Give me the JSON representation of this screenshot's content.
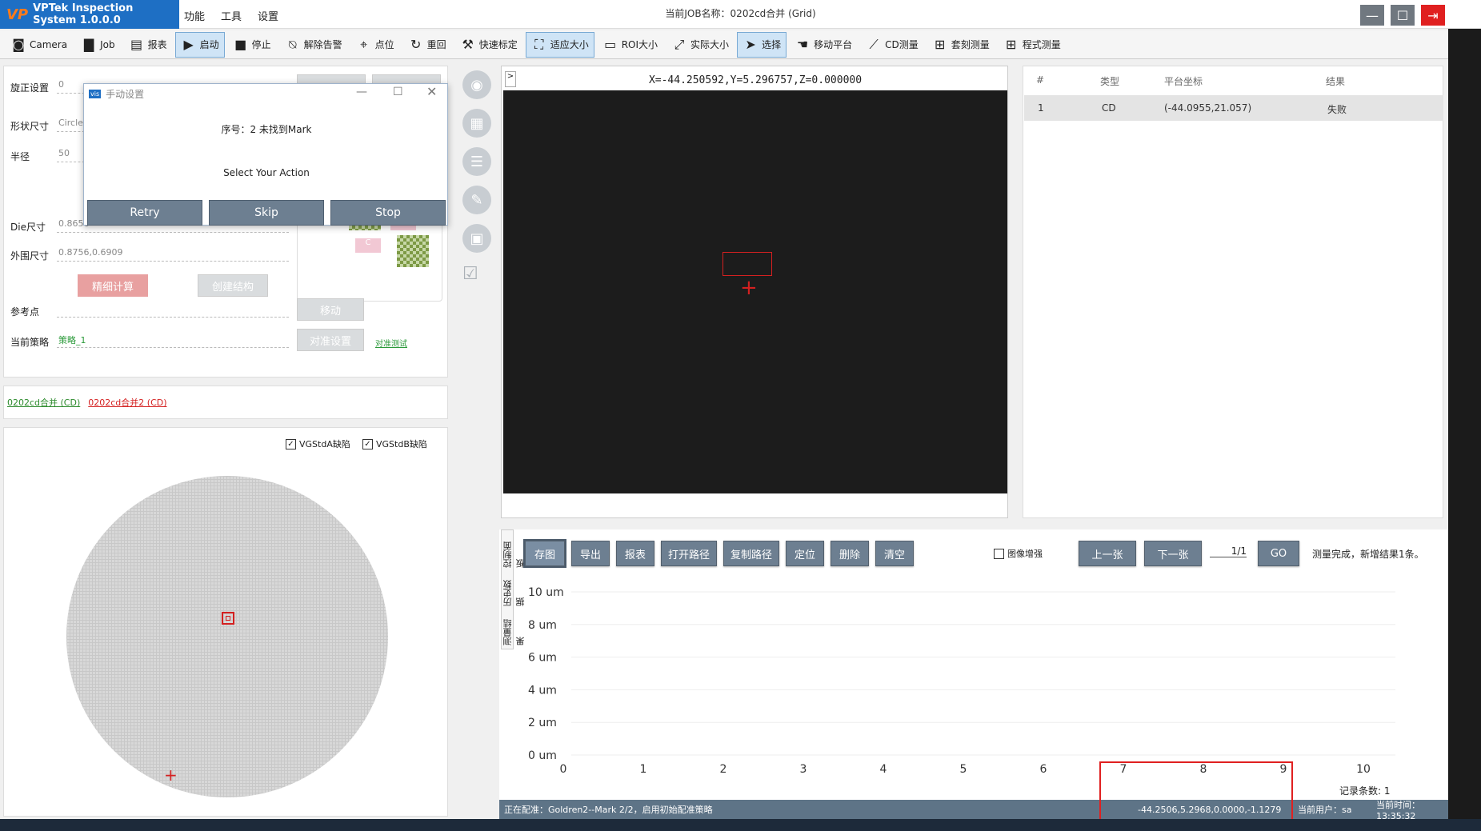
{
  "app": {
    "title": "VPTek Inspection System 1.0.0.0",
    "menus": [
      "功能",
      "工具",
      "设置"
    ],
    "job_title": "当前JOB名称：0202cd合并 (Grid)"
  },
  "toolbar": [
    {
      "label": "Camera",
      "icon": "camera-icon"
    },
    {
      "label": "Job",
      "icon": "briefcase-icon"
    },
    {
      "label": "报表",
      "icon": "report-icon"
    },
    {
      "label": "启动",
      "icon": "play-icon",
      "active": true
    },
    {
      "label": "停止",
      "icon": "stop-icon"
    },
    {
      "label": "解除告警",
      "icon": "bell-off-icon"
    },
    {
      "label": "点位",
      "icon": "pin-icon"
    },
    {
      "label": "重回",
      "icon": "refresh-icon"
    },
    {
      "label": "快速标定",
      "icon": "wrench-icon"
    },
    {
      "label": "适应大小",
      "icon": "fit-icon",
      "active": true
    },
    {
      "label": "ROI大小",
      "icon": "roi-icon"
    },
    {
      "label": "实际大小",
      "icon": "expand-icon"
    },
    {
      "label": "选择",
      "icon": "cursor-icon",
      "active": true
    },
    {
      "label": "移动平台",
      "icon": "hand-icon"
    },
    {
      "label": "CD测量",
      "icon": "ruler-icon"
    },
    {
      "label": "套刻测量",
      "icon": "plus-icon"
    },
    {
      "label": "程式测量",
      "icon": "plus-icon"
    }
  ],
  "left": {
    "rotate_label": "旋正设置",
    "rotate_value": "0",
    "shape_label": "形状尺寸",
    "shape_value": "Circle",
    "radius_label": "半径",
    "radius_value": "50",
    "die_label": "Die尺寸",
    "die_value": "0.8656",
    "outer_label": "外围尺寸",
    "outer_value": "0.8756,0.6909",
    "fine_calc": "精细计算",
    "create_struct": "创建结构",
    "ref_label": "参考点",
    "move": "移动",
    "strategy_label": "当前策略",
    "strategy_value": "策略_1",
    "align_settings": "对准设置",
    "align_test": "对准测试",
    "mini_c": "C"
  },
  "dialog": {
    "title": "手动设置",
    "message": "序号：2 未找到Mark",
    "prompt": "Select Your Action",
    "retry": "Retry",
    "skip": "Skip",
    "stop": "Stop"
  },
  "links": {
    "link1": "0202cd合并 (CD)",
    "link2": "0202cd合并2 (CD)"
  },
  "wafer": {
    "checkA": "VGStdA缺陷",
    "checkB": "VGStdB缺陷"
  },
  "image": {
    "coords": "X=-44.250592,Y=5.296757,Z=0.000000",
    "expand": ">"
  },
  "results": {
    "headers": [
      "#",
      "类型",
      "平台坐标",
      "结果"
    ],
    "rows": [
      [
        "1",
        "CD",
        "(-44.0955,21.057)",
        "失败"
      ]
    ]
  },
  "bottom": {
    "buttons": [
      "存图",
      "导出",
      "报表",
      "打开路径",
      "复制路径",
      "定位",
      "删除",
      "清空"
    ],
    "enhance": "图像增强",
    "prev": "上一张",
    "next": "下一张",
    "page": "1/1",
    "go": "GO",
    "message": "测量完成，新增结果1条。",
    "vtabs": [
      "测量结果",
      "历史数据",
      "控制面板"
    ],
    "record": "记录条数: 1"
  },
  "chart_data": {
    "type": "line",
    "x": [
      0,
      1,
      2,
      3,
      4,
      5,
      6,
      7,
      8,
      9,
      10
    ],
    "y_ticks": [
      "10 um",
      "8 um",
      "6 um",
      "4 um",
      "2 um",
      "0 um"
    ],
    "ylim": [
      0,
      10
    ],
    "series": []
  },
  "status": {
    "left": "正在配准：Goldren2--Mark 2/2，启用初始配准策略",
    "coords": "-44.2506,5.2968,0.0000,-1.1279",
    "user": "当前用户：sa",
    "time": "当前时间：13:35:32"
  },
  "colors": {
    "brand": "#1e6fc4",
    "button": "#6d7f91",
    "accent_red": "#e02020",
    "status": "#5e7487"
  }
}
